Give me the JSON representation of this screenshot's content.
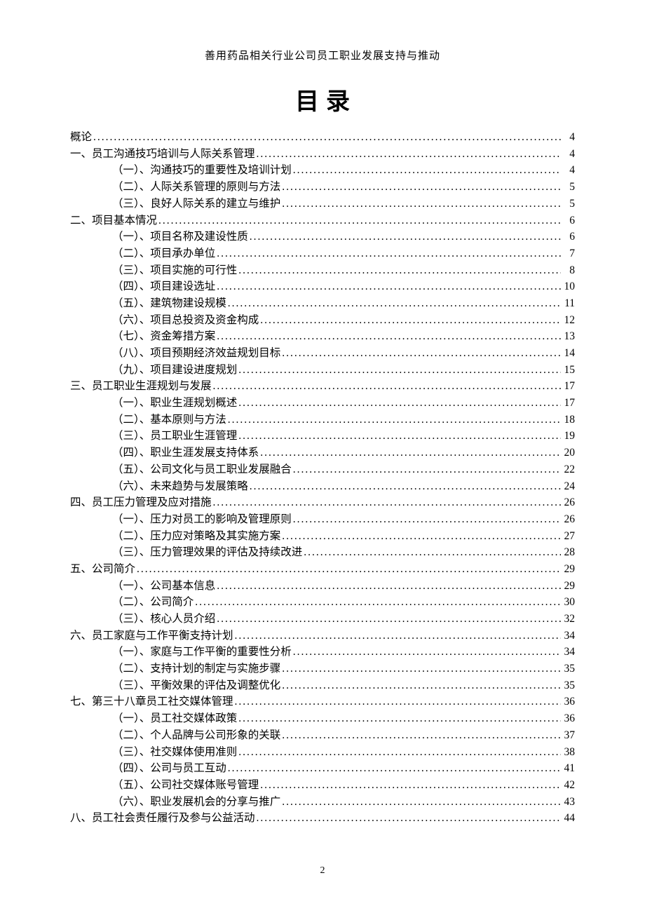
{
  "header": "善用药品相关行业公司员工职业发展支持与推动",
  "title": "目录",
  "page_number": "2",
  "toc": [
    {
      "level": 0,
      "text": "概论",
      "page": "4"
    },
    {
      "level": 0,
      "text": "一、员工沟通技巧培训与人际关系管理",
      "page": "4"
    },
    {
      "level": 1,
      "text": "（一）、沟通技巧的重要性及培训计划",
      "page": "4"
    },
    {
      "level": 1,
      "text": "（二）、人际关系管理的原则与方法",
      "page": "5"
    },
    {
      "level": 1,
      "text": "（三）、良好人际关系的建立与维护",
      "page": "5"
    },
    {
      "level": 0,
      "text": "二、项目基本情况",
      "page": "6"
    },
    {
      "level": 1,
      "text": "（一）、项目名称及建设性质",
      "page": "6"
    },
    {
      "level": 1,
      "text": "（二）、项目承办单位",
      "page": "7"
    },
    {
      "level": 1,
      "text": "（三）、项目实施的可行性",
      "page": "8"
    },
    {
      "level": 1,
      "text": "（四）、项目建设选址",
      "page": "10"
    },
    {
      "level": 1,
      "text": "（五）、建筑物建设规模",
      "page": "11"
    },
    {
      "level": 1,
      "text": "（六）、项目总投资及资金构成",
      "page": "12"
    },
    {
      "level": 1,
      "text": "（七）、资金筹措方案",
      "page": "13"
    },
    {
      "level": 1,
      "text": "（八）、项目预期经济效益规划目标",
      "page": "14"
    },
    {
      "level": 1,
      "text": "（九）、项目建设进度规划",
      "page": "15"
    },
    {
      "level": 0,
      "text": "三、员工职业生涯规划与发展",
      "page": "17"
    },
    {
      "level": 1,
      "text": "（一）、职业生涯规划概述",
      "page": "17"
    },
    {
      "level": 1,
      "text": "（二）、基本原则与方法",
      "page": "18"
    },
    {
      "level": 1,
      "text": "（三）、员工职业生涯管理",
      "page": "19"
    },
    {
      "level": 1,
      "text": "（四）、职业生涯发展支持体系",
      "page": "20"
    },
    {
      "level": 1,
      "text": "（五）、公司文化与员工职业发展融合",
      "page": "22"
    },
    {
      "level": 1,
      "text": "（六）、未来趋势与发展策略",
      "page": "24"
    },
    {
      "level": 0,
      "text": "四、员工压力管理及应对措施",
      "page": "26"
    },
    {
      "level": 1,
      "text": "（一）、压力对员工的影响及管理原则",
      "page": "26"
    },
    {
      "level": 1,
      "text": "（二）、压力应对策略及其实施方案",
      "page": "27"
    },
    {
      "level": 1,
      "text": "（三）、压力管理效果的评估及持续改进",
      "page": "28"
    },
    {
      "level": 0,
      "text": "五、公司简介",
      "page": "29"
    },
    {
      "level": 1,
      "text": "（一）、公司基本信息",
      "page": "29"
    },
    {
      "level": 1,
      "text": "（二）、公司简介",
      "page": "30"
    },
    {
      "level": 1,
      "text": "（三）、核心人员介绍",
      "page": "32"
    },
    {
      "level": 0,
      "text": "六、员工家庭与工作平衡支持计划",
      "page": "34"
    },
    {
      "level": 1,
      "text": "（一）、家庭与工作平衡的重要性分析",
      "page": "34"
    },
    {
      "level": 1,
      "text": "（二）、支持计划的制定与实施步骤",
      "page": "35"
    },
    {
      "level": 1,
      "text": "（三）、平衡效果的评估及调整优化",
      "page": "35"
    },
    {
      "level": 0,
      "text": "七、第三十八章员工社交媒体管理",
      "page": "36"
    },
    {
      "level": 1,
      "text": "（一）、员工社交媒体政策",
      "page": "36"
    },
    {
      "level": 1,
      "text": "（二）、个人品牌与公司形象的关联",
      "page": "37"
    },
    {
      "level": 1,
      "text": "（三）、社交媒体使用准则",
      "page": "38"
    },
    {
      "level": 1,
      "text": "（四）、公司与员工互动",
      "page": "41"
    },
    {
      "level": 1,
      "text": "（五）、公司社交媒体账号管理",
      "page": "42"
    },
    {
      "level": 1,
      "text": "（六）、职业发展机会的分享与推广",
      "page": "43"
    },
    {
      "level": 0,
      "text": "八、员工社会责任履行及参与公益活动",
      "page": "44"
    }
  ]
}
